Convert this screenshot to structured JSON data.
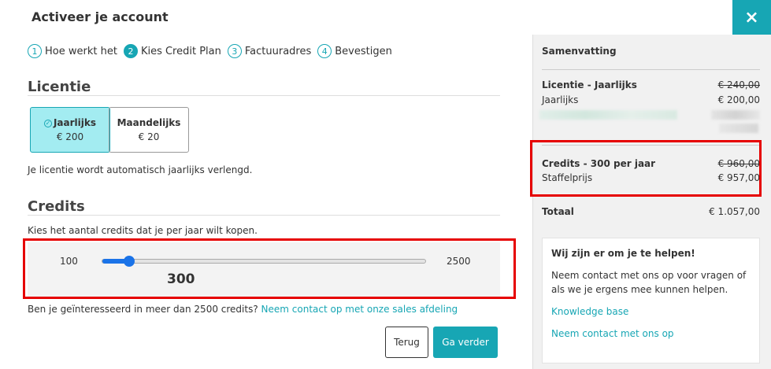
{
  "header": {
    "title": "Activeer je account",
    "close_icon": "×"
  },
  "steps": [
    {
      "num": "1",
      "label": "Hoe werkt het",
      "active": false
    },
    {
      "num": "2",
      "label": "Kies Credit Plan",
      "active": true
    },
    {
      "num": "3",
      "label": "Factuuradres",
      "active": false
    },
    {
      "num": "4",
      "label": "Bevestigen",
      "active": false
    }
  ],
  "license": {
    "heading": "Licentie",
    "plans": [
      {
        "name": "Jaarlijks",
        "price": "€ 200",
        "selected": true
      },
      {
        "name": "Maandelijks",
        "price": "€ 20",
        "selected": false
      }
    ],
    "note": "Je licentie wordt automatisch jaarlijks verlengd."
  },
  "credits": {
    "heading": "Credits",
    "instruction": "Kies het aantal credits dat je per jaar wilt kopen.",
    "slider_min": "100",
    "slider_max": "2500",
    "slider_value": "300",
    "slider_fraction": 0.0833,
    "more_text": "Ben je geïnteresseerd in meer dan 2500 credits?",
    "contact_link": "Neem contact op met onze sales afdeling"
  },
  "buttons": {
    "back": "Terug",
    "next": "Ga verder"
  },
  "summary": {
    "title": "Samenvatting",
    "license_label": "Licentie - Jaarlijks",
    "license_old": "€ 240,00",
    "license_sub": "Jaarlijks",
    "license_price": "€ 200,00",
    "credits_label": "Credits - 300 per jaar",
    "credits_old": "€ 960,00",
    "credits_sub": "Staffelprijs",
    "credits_price": "€ 957,00",
    "total_label": "Totaal",
    "total_value": "€ 1.057,00"
  },
  "help": {
    "title": "Wij zijn er om je te helpen!",
    "text": "Neem contact met ons op voor vragen of als we je ergens mee kunnen helpen.",
    "link_kb": "Knowledge base",
    "link_contact": "Neem contact met ons op"
  },
  "colors": {
    "accent": "#17a6b4",
    "selected_plan_bg": "#a3ecf1",
    "slider": "#1a73e8",
    "highlight": "#e60000"
  }
}
